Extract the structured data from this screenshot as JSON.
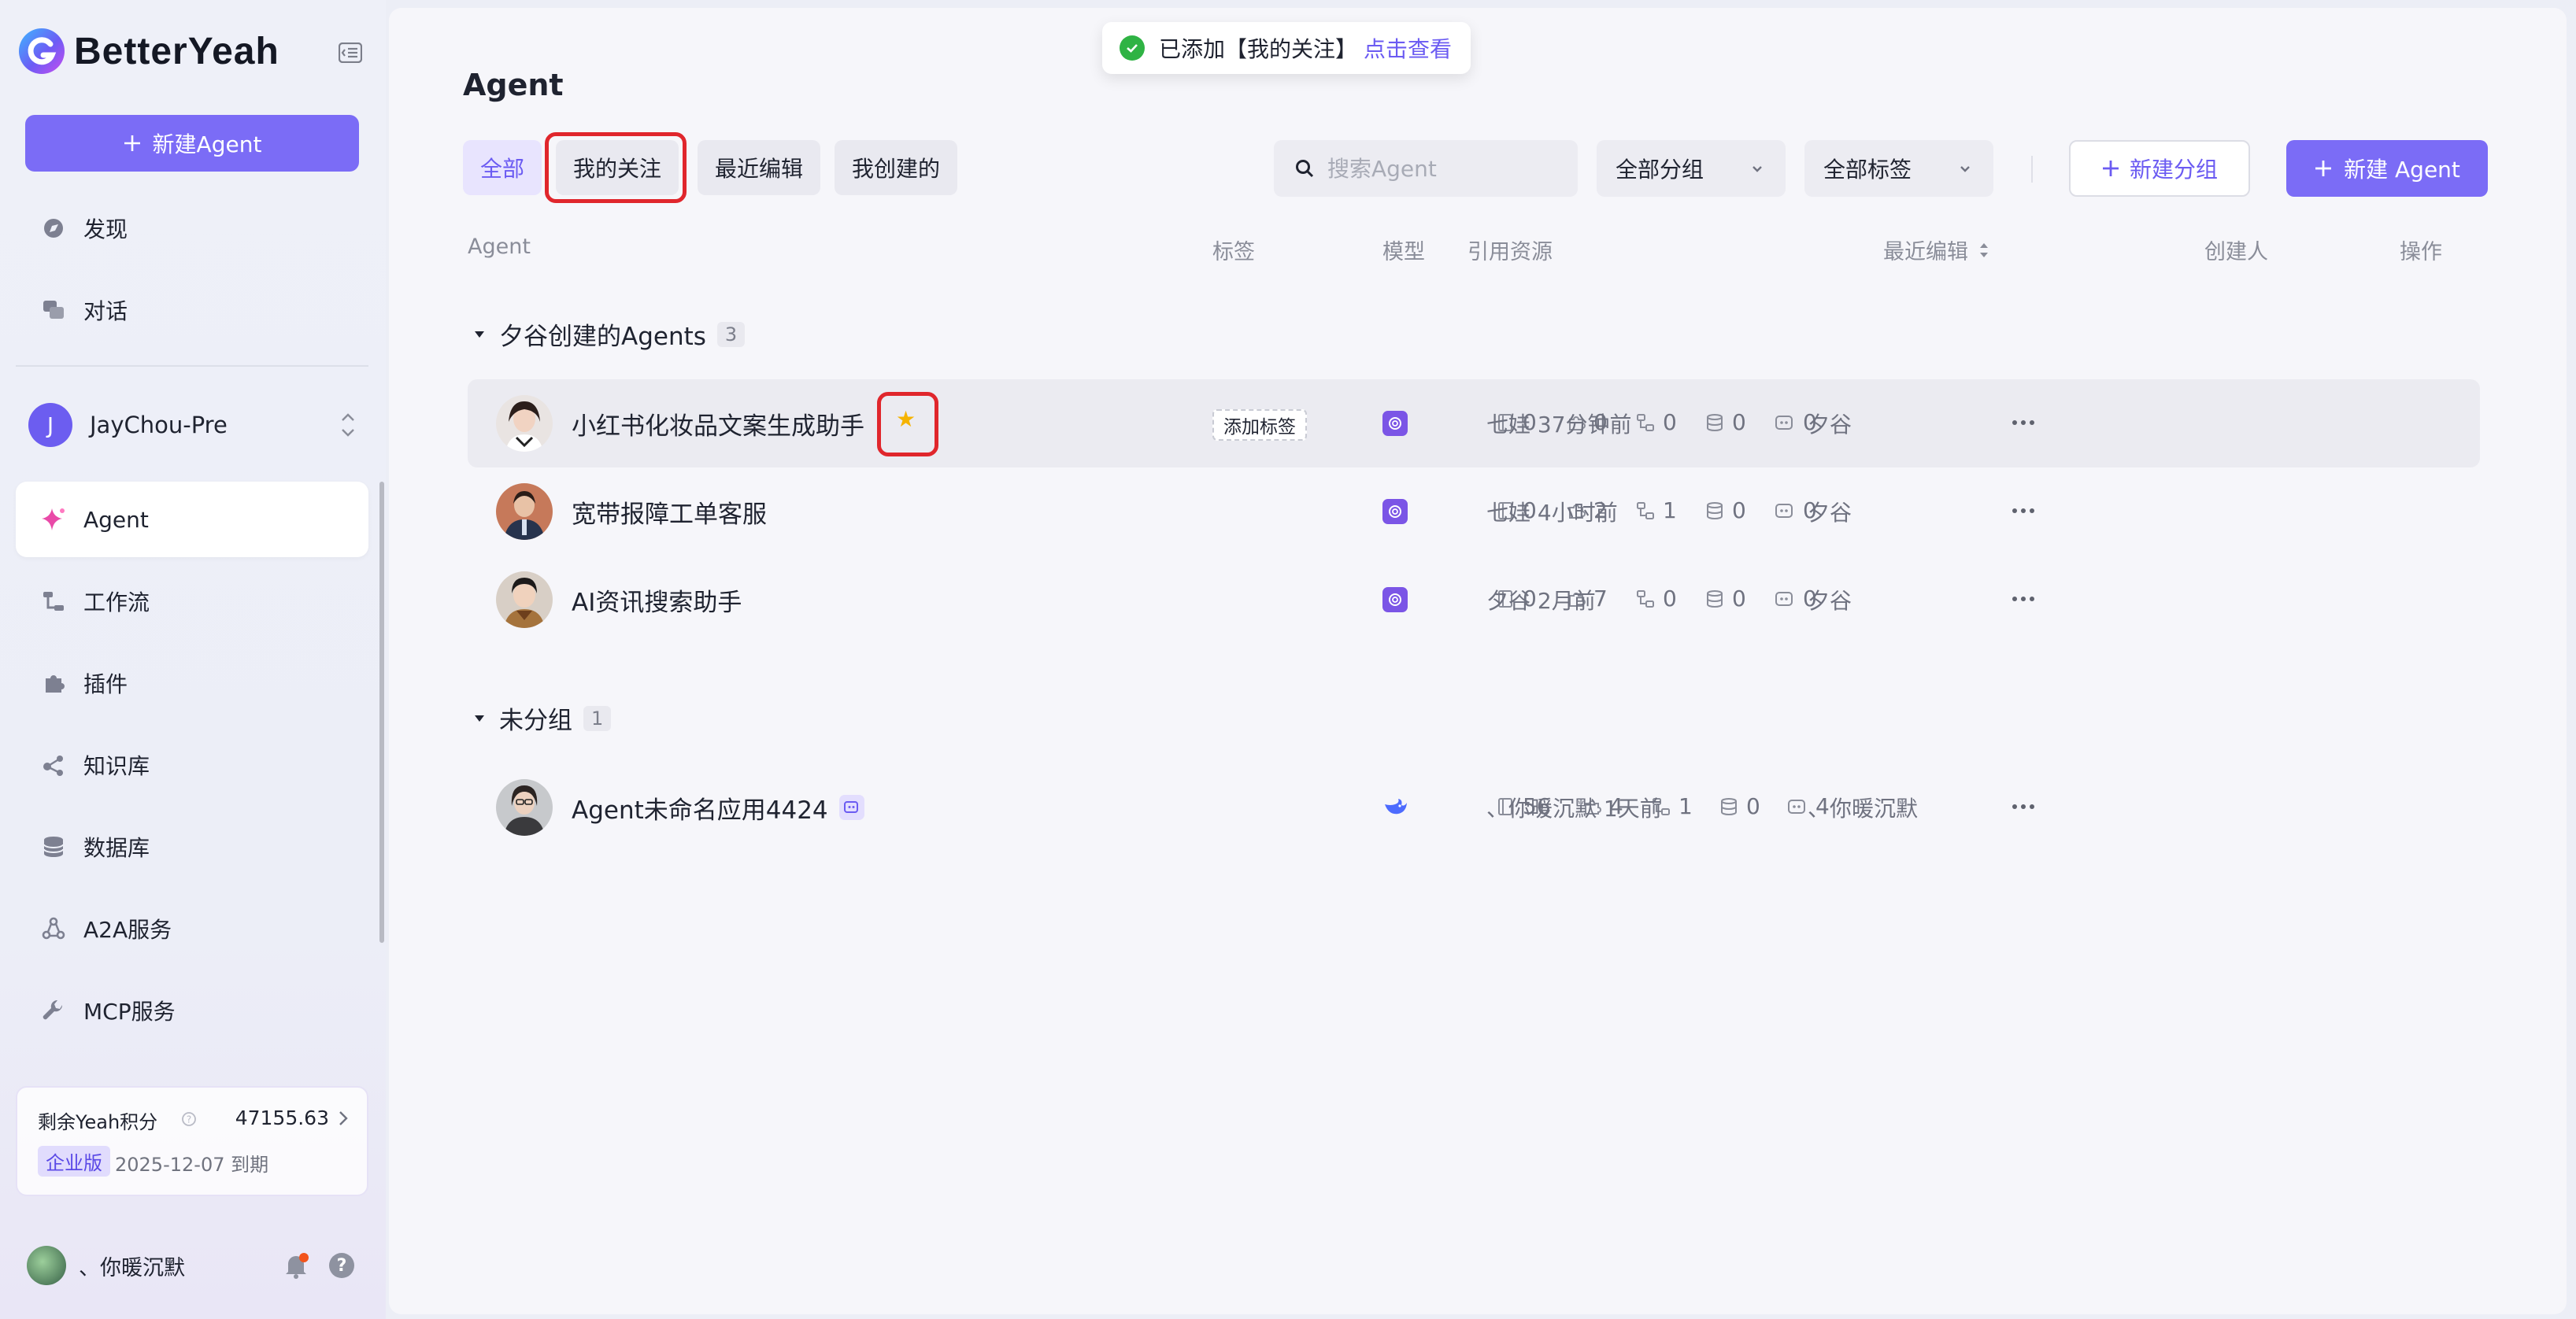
{
  "app": {
    "name": "BetterYeah"
  },
  "sidebar": {
    "new_agent_label": "新建Agent",
    "top_items": [
      {
        "label": "发现",
        "icon": "compass-icon"
      },
      {
        "label": "对话",
        "icon": "chat-icon"
      }
    ],
    "workspace": {
      "initial": "J",
      "name": "JayChou-Pre"
    },
    "items": [
      {
        "label": "Agent",
        "icon": "sparkle-icon",
        "active": true
      },
      {
        "label": "工作流",
        "icon": "workflow-icon"
      },
      {
        "label": "插件",
        "icon": "puzzle-icon"
      },
      {
        "label": "知识库",
        "icon": "knowledge-icon"
      },
      {
        "label": "数据库",
        "icon": "database-icon"
      },
      {
        "label": "A2A服务",
        "icon": "a2a-icon"
      },
      {
        "label": "MCP服务",
        "icon": "wrench-icon"
      }
    ],
    "points": {
      "label": "剩余Yeah积分",
      "value": "47155.63",
      "plan": "企业版",
      "expire": "2025-12-07 到期"
    },
    "user": {
      "name": "、你暖沉默"
    }
  },
  "toast": {
    "message": "已添加【我的关注】",
    "link": "点击查看"
  },
  "main": {
    "title": "Agent",
    "tabs": [
      "全部",
      "我的关注",
      "最近编辑",
      "我创建的"
    ],
    "search_placeholder": "搜索Agent",
    "group_filter": "全部分组",
    "tag_filter": "全部标签",
    "new_group_label": "新建分组",
    "new_agent_label": "新建 Agent",
    "columns": {
      "agent": "Agent",
      "tags": "标签",
      "model": "模型",
      "resources": "引用资源",
      "last_edit": "最近编辑",
      "creator": "创建人",
      "actions": "操作"
    },
    "groups": [
      {
        "name": "夕谷创建的Agents",
        "count": "3",
        "rows": [
          {
            "name": "小红书化妆品文案生成助手",
            "tag_action": "添加标签",
            "res": [
              "0",
              "0",
              "0",
              "0",
              "0"
            ],
            "last_edit": "七娃 37分钟前",
            "creator": "夕谷"
          },
          {
            "name": "宽带报障工单客服",
            "res": [
              "0",
              "2",
              "1",
              "0",
              "0"
            ],
            "last_edit": "七娃 4小时前",
            "creator": "夕谷"
          },
          {
            "name": "AI资讯搜索助手",
            "res": [
              "0",
              "7",
              "0",
              "0",
              "0"
            ],
            "last_edit": "夕谷 2月前",
            "creator": "夕谷"
          }
        ]
      },
      {
        "name": "未分组",
        "count": "1",
        "rows": [
          {
            "name": "Agent未命名应用4424",
            "res": [
              "56",
              "4",
              "1",
              "0",
              "4"
            ],
            "last_edit": "、你暖沉默 1天前",
            "creator": "、你暖沉默"
          }
        ]
      }
    ]
  },
  "colors": {
    "accent": "#7b6cf6",
    "highlight": "#e0262c",
    "star": "#f5b300",
    "success": "#2fb344"
  }
}
